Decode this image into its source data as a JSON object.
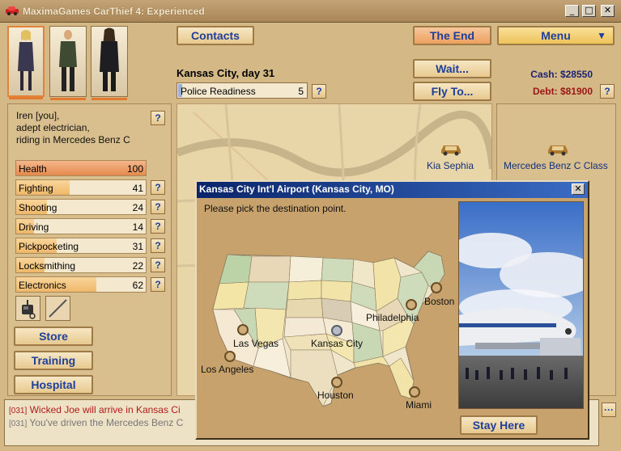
{
  "window": {
    "title": "MaximaGames CarThief 4: Experienced",
    "minimize": "_",
    "maximize": "□",
    "close": "✕"
  },
  "header": {
    "contacts": "Contacts",
    "the_end": "The End",
    "menu": "Menu",
    "menu_arrow": "▼",
    "wait": "Wait...",
    "fly_to": "Fly To...",
    "location": "Kansas City, day 31",
    "police": {
      "label": "Police Readiness",
      "value": "5"
    },
    "cash": "Cash: $28550",
    "debt": "Debt: $81900",
    "help": "?"
  },
  "character": {
    "description": [
      "Iren [you],",
      "adept electrician,",
      "riding in Mercedes Benz C"
    ],
    "stats": [
      {
        "label": "Health",
        "value": "100",
        "level": 1.0
      },
      {
        "label": "Fighting",
        "value": "41",
        "level": 0.41
      },
      {
        "label": "Shooting",
        "value": "24",
        "level": 0.24
      },
      {
        "label": "Driving",
        "value": "14",
        "level": 0.14
      },
      {
        "label": "Pickpocketing",
        "value": "31",
        "level": 0.31
      },
      {
        "label": "Locksmithing",
        "value": "22",
        "level": 0.22
      },
      {
        "label": "Electronics",
        "value": "62",
        "level": 0.62
      }
    ],
    "store": "Store",
    "training": "Training",
    "hospital": "Hospital"
  },
  "map": {
    "car_label": "Kia Sephia"
  },
  "garage": {
    "car_label": "Mercedes Benz C Class"
  },
  "log": {
    "lines": [
      {
        "ts": "[031]",
        "text": " Wicked Joe will arrive in Kansas Ci",
        "color": "#b01a1a"
      },
      {
        "ts": "[031]",
        "text": " You've driven the Mercedes Benz C",
        "color": "#777777"
      }
    ],
    "more": "···"
  },
  "dialog": {
    "title": "Kansas City Int'l Airport (Kansas City, MO)",
    "close": "✕",
    "prompt": "Please pick the destination point.",
    "cities": {
      "las_vegas": "Las Vegas",
      "los_angeles": "Los Angeles",
      "kansas_city": "Kansas City",
      "houston": "Houston",
      "miami": "Miami",
      "philadelphia": "Philadelphia",
      "boston": "Boston"
    },
    "stay_here": "Stay Here"
  },
  "colors": {
    "accent_blue": "#1f3f9a",
    "debt_red": "#9b1717",
    "cash_navy": "#1c2472",
    "title_bar": "#0a246a"
  }
}
